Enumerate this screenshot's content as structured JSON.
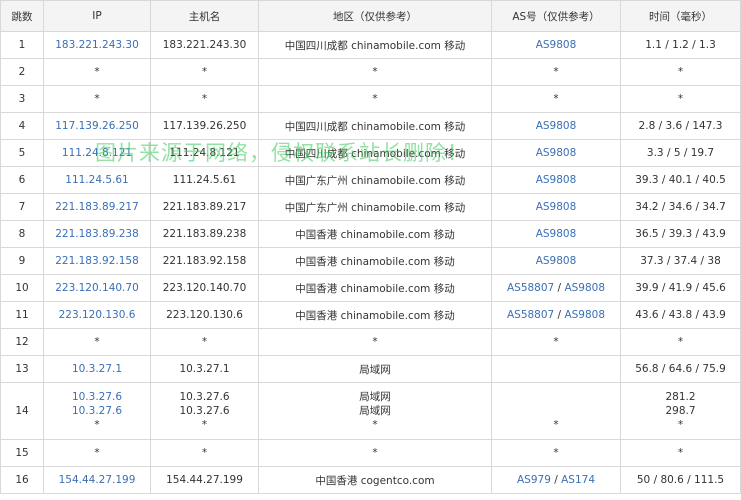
{
  "headers": [
    "跳数",
    "IP",
    "主机名",
    "地区（仅供参考）",
    "AS号（仅供参考）",
    "时间（毫秒）"
  ],
  "rows": [
    {
      "hop": "1",
      "ip": [
        "183.221.243.30"
      ],
      "host": [
        "183.221.243.30"
      ],
      "region": [
        "中国四川成都 chinamobile.com 移动"
      ],
      "as": [
        "AS9808"
      ],
      "time": [
        "1.1 / 1.2 / 1.3"
      ]
    },
    {
      "hop": "2",
      "ip": [
        "*"
      ],
      "host": [
        "*"
      ],
      "region": [
        "*"
      ],
      "as": [
        "*"
      ],
      "time": [
        "*"
      ]
    },
    {
      "hop": "3",
      "ip": [
        "*"
      ],
      "host": [
        "*"
      ],
      "region": [
        "*"
      ],
      "as": [
        "*"
      ],
      "time": [
        "*"
      ]
    },
    {
      "hop": "4",
      "ip": [
        "117.139.26.250"
      ],
      "host": [
        "117.139.26.250"
      ],
      "region": [
        "中国四川成都 chinamobile.com 移动"
      ],
      "as": [
        "AS9808"
      ],
      "time": [
        "2.8 / 3.6 / 147.3"
      ]
    },
    {
      "hop": "5",
      "ip": [
        "111.24.8.121"
      ],
      "host": [
        "111.24.8.121"
      ],
      "region": [
        "中国四川成都 chinamobile.com 移动"
      ],
      "as": [
        "AS9808"
      ],
      "time": [
        "3.3 / 5 / 19.7"
      ]
    },
    {
      "hop": "6",
      "ip": [
        "111.24.5.61"
      ],
      "host": [
        "111.24.5.61"
      ],
      "region": [
        "中国广东广州 chinamobile.com 移动"
      ],
      "as": [
        "AS9808"
      ],
      "time": [
        "39.3 / 40.1 / 40.5"
      ]
    },
    {
      "hop": "7",
      "ip": [
        "221.183.89.217"
      ],
      "host": [
        "221.183.89.217"
      ],
      "region": [
        "中国广东广州 chinamobile.com 移动"
      ],
      "as": [
        "AS9808"
      ],
      "time": [
        "34.2 / 34.6 / 34.7"
      ]
    },
    {
      "hop": "8",
      "ip": [
        "221.183.89.238"
      ],
      "host": [
        "221.183.89.238"
      ],
      "region": [
        "中国香港 chinamobile.com 移动"
      ],
      "as": [
        "AS9808"
      ],
      "time": [
        "36.5 / 39.3 / 43.9"
      ]
    },
    {
      "hop": "9",
      "ip": [
        "221.183.92.158"
      ],
      "host": [
        "221.183.92.158"
      ],
      "region": [
        "中国香港 chinamobile.com 移动"
      ],
      "as": [
        "AS9808"
      ],
      "time": [
        "37.3 / 37.4 / 38"
      ]
    },
    {
      "hop": "10",
      "ip": [
        "223.120.140.70"
      ],
      "host": [
        "223.120.140.70"
      ],
      "region": [
        "中国香港 chinamobile.com 移动"
      ],
      "as": [
        "AS58807",
        "AS9808"
      ],
      "time": [
        "39.9 / 41.9 / 45.6"
      ]
    },
    {
      "hop": "11",
      "ip": [
        "223.120.130.6"
      ],
      "host": [
        "223.120.130.6"
      ],
      "region": [
        "中国香港 chinamobile.com 移动"
      ],
      "as": [
        "AS58807",
        "AS9808"
      ],
      "time": [
        "43.6 / 43.8 / 43.9"
      ]
    },
    {
      "hop": "12",
      "ip": [
        "*"
      ],
      "host": [
        "*"
      ],
      "region": [
        "*"
      ],
      "as": [
        "*"
      ],
      "time": [
        "*"
      ]
    },
    {
      "hop": "13",
      "ip": [
        "10.3.27.1"
      ],
      "host": [
        "10.3.27.1"
      ],
      "region": [
        "局域网"
      ],
      "as": [],
      "time": [
        "56.8 / 64.6 / 75.9"
      ]
    },
    {
      "hop": "14",
      "ip": [
        "10.3.27.6",
        "10.3.27.6",
        "*"
      ],
      "host": [
        "10.3.27.6",
        "10.3.27.6",
        "*"
      ],
      "region": [
        "局域网",
        "局域网",
        "*"
      ],
      "as_multiline": [
        "",
        "",
        "*"
      ],
      "time": [
        "281.2",
        "298.7",
        "*"
      ]
    },
    {
      "hop": "15",
      "ip": [
        "*"
      ],
      "host": [
        "*"
      ],
      "region": [
        "*"
      ],
      "as": [
        "*"
      ],
      "time": [
        "*"
      ]
    },
    {
      "hop": "16",
      "ip": [
        "154.44.27.199"
      ],
      "host": [
        "154.44.27.199"
      ],
      "region": [
        "中国香港 cogentco.com"
      ],
      "as": [
        "AS979",
        "AS174"
      ],
      "time": [
        "50 / 80.6 / 111.5"
      ]
    }
  ],
  "watermark": "图片来源于网络，侵权联系站长删除！",
  "colors": {
    "link": "#3a6fb5",
    "header_bg": "#f4f4f4",
    "border": "#d8d8d8",
    "watermark": "#3cc85a"
  }
}
